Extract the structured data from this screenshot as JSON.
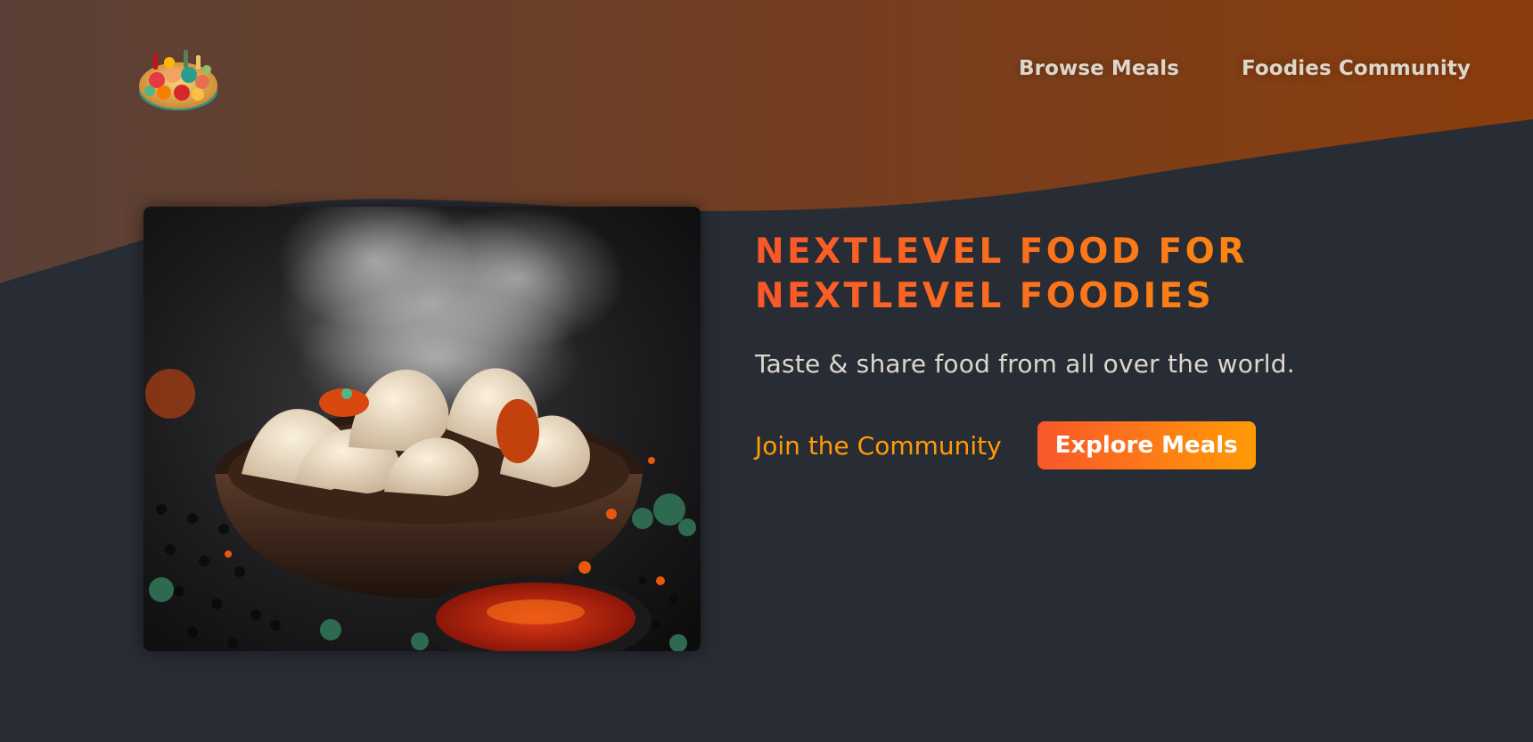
{
  "header": {
    "logo_icon": "food-platter-icon",
    "nav": {
      "browse_meals": "Browse Meals",
      "community": "Foodies Community"
    }
  },
  "hero": {
    "image_icon": "steamed-dumplings-photo",
    "headline_line1": "NEXTLEVEL FOOD FOR",
    "headline_line2": "NEXTLEVEL FOODIES",
    "tagline": "Taste & share food from all over the world.",
    "cta_link": "Join the Community",
    "cta_button": "Explore Meals"
  },
  "colors": {
    "background": "#282c34",
    "header_gradient_start": "#5a4037",
    "header_gradient_end": "#8a3e0e",
    "accent_start": "#f9572a",
    "accent_end": "#ff9b05",
    "nav_text": "#ddd6cb"
  }
}
